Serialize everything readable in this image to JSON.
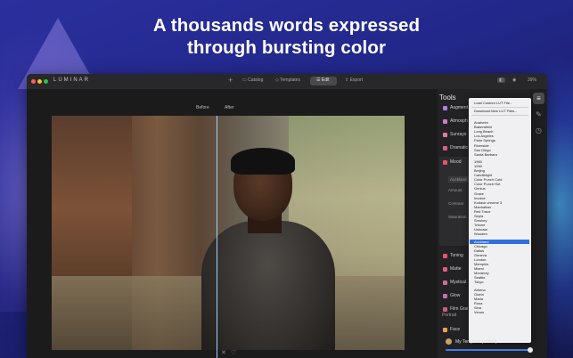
{
  "headline": {
    "line1": "A thousands words expressed",
    "line2": "through bursting color"
  },
  "app": {
    "name": "LUMINAR"
  },
  "toolbar": {
    "catalog": "Catalog",
    "templates": "Templates",
    "edit": "Edit",
    "export": "Export",
    "zoom": "39%"
  },
  "canvas": {
    "before": "Before",
    "after": "After"
  },
  "tools": {
    "title": "Tools",
    "items": [
      "Augment",
      "Atmosph",
      "Sunrays",
      "Dramatic",
      "Mood",
      "Toning",
      "Matte",
      "Mystical",
      "Glow",
      "Film Grai"
    ],
    "mood_sub": [
      "Auckland",
      "Amount",
      "Contrast",
      "Saturation"
    ],
    "portrait": "Portrait",
    "face": "Face"
  },
  "lut_menu": {
    "load": "Load Custom LUT File...",
    "download": "Download New LUT Files...",
    "cities1": [
      "Anaheim",
      "Bakersfield",
      "Long Beach",
      "Los Angeles",
      "Palm Springs",
      "Riverside",
      "San Diego",
      "Santa Barbara"
    ],
    "creative": [
      "1960",
      "1990",
      "Beijing",
      "Candlelight",
      "Color Punch Cold",
      "Color Punch Hot",
      "Genius",
      "Grace",
      "Invoice",
      "Kodack chrome 3",
      "Manhattan",
      "Red Trace",
      "Sepia",
      "Smokey",
      "Tritone",
      "Ushuaia",
      "Wooden"
    ],
    "selected": "Auckland",
    "cities2": [
      "Chicago",
      "Dallas",
      "Geneva",
      "London",
      "Memphis",
      "Miami",
      "Monterey",
      "Seattle",
      "Tokyo"
    ],
    "portrait": [
      "Athena",
      "Gloria",
      "Maria",
      "Rosa",
      "Sina",
      "Venus"
    ]
  },
  "template": {
    "label": "My Template (edited)"
  },
  "colors": {
    "accent": "#2f6fe0",
    "background": "#22288a"
  }
}
